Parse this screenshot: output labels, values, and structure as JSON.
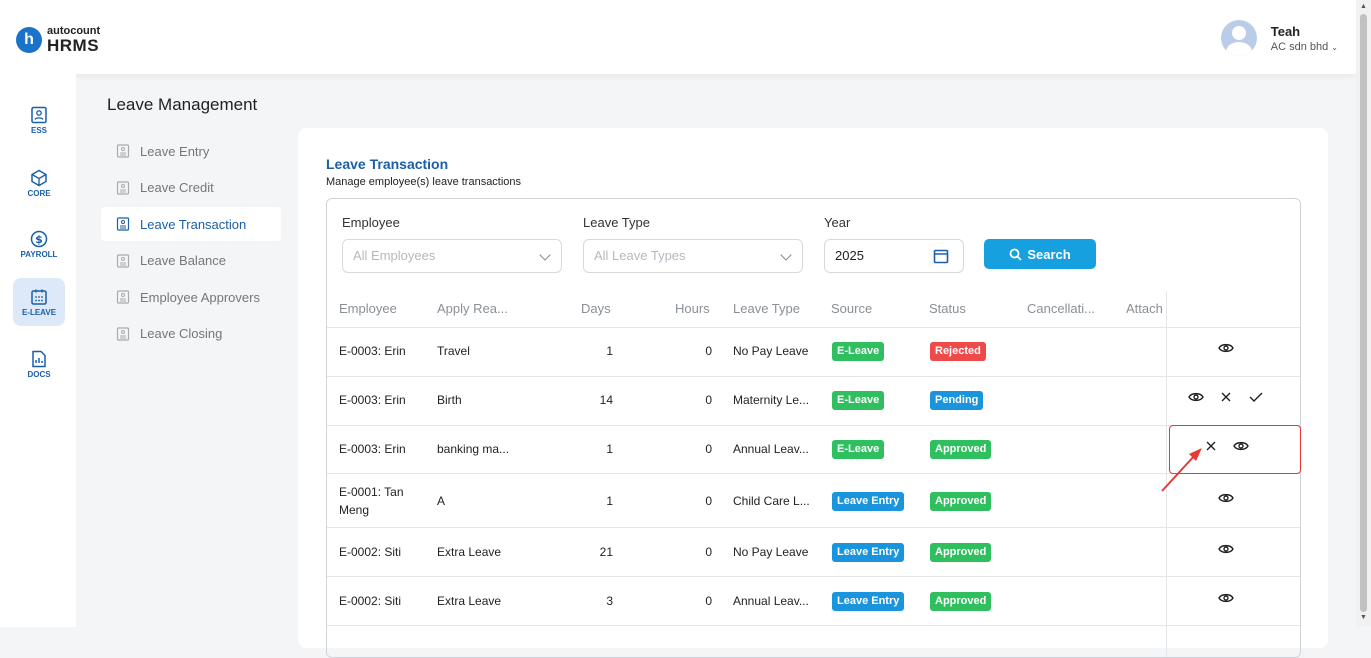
{
  "app": {
    "logo_small": "autocount",
    "logo_big": "HRMS",
    "logo_letter": "h"
  },
  "user": {
    "name": "Teah",
    "company": "AC sdn bhd"
  },
  "rail": [
    {
      "label": "ESS",
      "icon": "ess-icon"
    },
    {
      "label": "CORE",
      "icon": "core-icon"
    },
    {
      "label": "PAYROLL",
      "icon": "payroll-icon"
    },
    {
      "label": "E-LEAVE",
      "icon": "e-leave-icon"
    },
    {
      "label": "DOCS",
      "icon": "docs-icon"
    }
  ],
  "page_title": "Leave Management",
  "leftnav": [
    {
      "label": "Leave Entry"
    },
    {
      "label": "Leave Credit"
    },
    {
      "label": "Leave Transaction"
    },
    {
      "label": "Leave Balance"
    },
    {
      "label": "Employee Approvers"
    },
    {
      "label": "Leave Closing"
    }
  ],
  "card": {
    "title": "Leave Transaction",
    "subtitle": "Manage employee(s) leave transactions"
  },
  "filters": {
    "employee_label": "Employee",
    "employee_placeholder": "All Employees",
    "leave_type_label": "Leave Type",
    "leave_type_placeholder": "All Leave Types",
    "year_label": "Year",
    "year_value": "2025",
    "search_label": "Search"
  },
  "table": {
    "headers": [
      "Employee",
      "Apply Rea...",
      "Days",
      "Hours",
      "Leave Type",
      "Source",
      "Status",
      "Cancellati...",
      "Attach"
    ],
    "rows": [
      {
        "employee": "E-0003: Erin",
        "reason": "Travel",
        "days": "1",
        "hours": "0",
        "leave_type": "No Pay Leave",
        "source": "E-Leave",
        "status": "Rejected"
      },
      {
        "employee": "E-0003: Erin",
        "reason": "Birth",
        "days": "14",
        "hours": "0",
        "leave_type": "Maternity Le...",
        "source": "E-Leave",
        "status": "Pending"
      },
      {
        "employee": "E-0003: Erin",
        "reason": "banking ma...",
        "days": "1",
        "hours": "0",
        "leave_type": "Annual Leav...",
        "source": "E-Leave",
        "status": "Approved"
      },
      {
        "employee": "E-0001: Tan",
        "employee_line2": "Meng",
        "reason": "A",
        "days": "1",
        "hours": "0",
        "leave_type": "Child Care L...",
        "source": "Leave Entry",
        "status": "Approved"
      },
      {
        "employee": "E-0002: Siti",
        "reason": "Extra Leave",
        "days": "21",
        "hours": "0",
        "leave_type": "No Pay Leave",
        "source": "Leave Entry",
        "status": "Approved"
      },
      {
        "employee": "E-0002: Siti",
        "reason": "Extra Leave",
        "days": "3",
        "hours": "0",
        "leave_type": "Annual Leav...",
        "source": "Leave Entry",
        "status": "Approved"
      }
    ]
  },
  "colors": {
    "brand": "#1a73c9",
    "search_button": "#16a0e0",
    "badge_green": "#2fbf5f",
    "badge_blue": "#1a94dc",
    "badge_red": "#ef4a4a",
    "annotation_red": "#e53935"
  }
}
